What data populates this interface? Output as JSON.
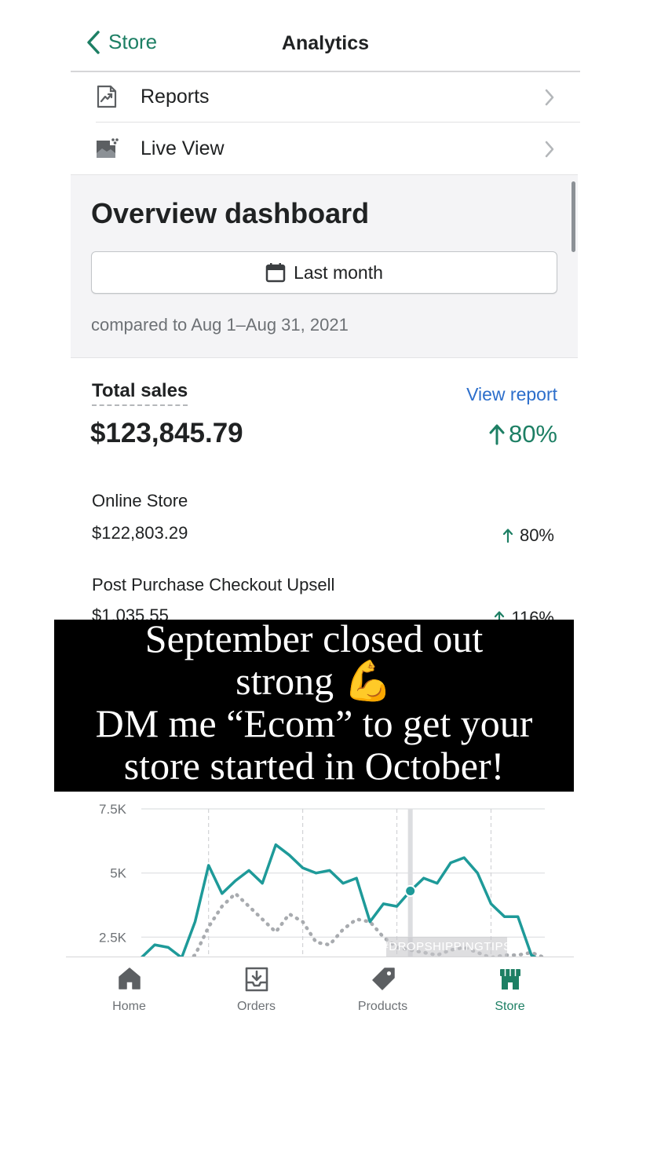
{
  "nav": {
    "back_label": "Store",
    "title": "Analytics"
  },
  "menu": [
    {
      "label": "Reports",
      "icon": "reports-icon"
    },
    {
      "label": "Live View",
      "icon": "live-view-icon"
    }
  ],
  "overview": {
    "title": "Overview dashboard",
    "range_button": "Last month",
    "compared": "compared to Aug 1–Aug 31, 2021"
  },
  "total_sales": {
    "label": "Total sales",
    "view_report": "View report",
    "value": "$123,845.79",
    "change": "80%"
  },
  "channels": [
    {
      "name": "Online Store",
      "value": "$122,803.29",
      "change": "80%"
    },
    {
      "name": "Post Purchase Checkout Upsell",
      "value": "$1,035.55",
      "change": "116%"
    }
  ],
  "overlay": {
    "lines": [
      "September closed out",
      "strong 💪",
      "DM me “Ecom” to get your",
      "store started in October!"
    ]
  },
  "chart_data": {
    "type": "line",
    "y_ticks": [
      "7.5K",
      "5K",
      "2.5K"
    ],
    "ylim": [
      0,
      7500
    ],
    "grid": true,
    "series": [
      {
        "style": "solid",
        "color": "#1e9a99",
        "values": [
          1700,
          2200,
          2100,
          1700,
          3100,
          5300,
          4200,
          4700,
          5100,
          4600,
          6100,
          5700,
          5200,
          5000,
          5100,
          4600,
          4800,
          3100,
          3800,
          3700,
          4300,
          4800,
          4600,
          5400,
          5600,
          5000,
          3800,
          3300,
          3300,
          1800,
          1500
        ],
        "selected_index": 20
      },
      {
        "style": "dotted",
        "color": "#a8abaf",
        "values": [
          1200,
          1400,
          1300,
          1500,
          1800,
          2900,
          3700,
          4200,
          3700,
          3200,
          2700,
          3400,
          3100,
          2300,
          2200,
          2800,
          3200,
          3100,
          2500,
          2100,
          2000,
          1900,
          1800,
          2000,
          2100,
          1900,
          1700,
          1800,
          1800,
          1900,
          1700
        ]
      }
    ]
  },
  "watermark": "#DROPSHIPPINGTIPS",
  "tabbar": [
    {
      "label": "Home",
      "icon": "home-icon"
    },
    {
      "label": "Orders",
      "icon": "orders-icon"
    },
    {
      "label": "Products",
      "icon": "products-icon"
    },
    {
      "label": "Store",
      "icon": "store-icon",
      "active": true
    }
  ],
  "colors": {
    "accent": "#1d7f64",
    "link": "#2c6ecb",
    "text": "#202223",
    "subdued": "#6d7175"
  }
}
